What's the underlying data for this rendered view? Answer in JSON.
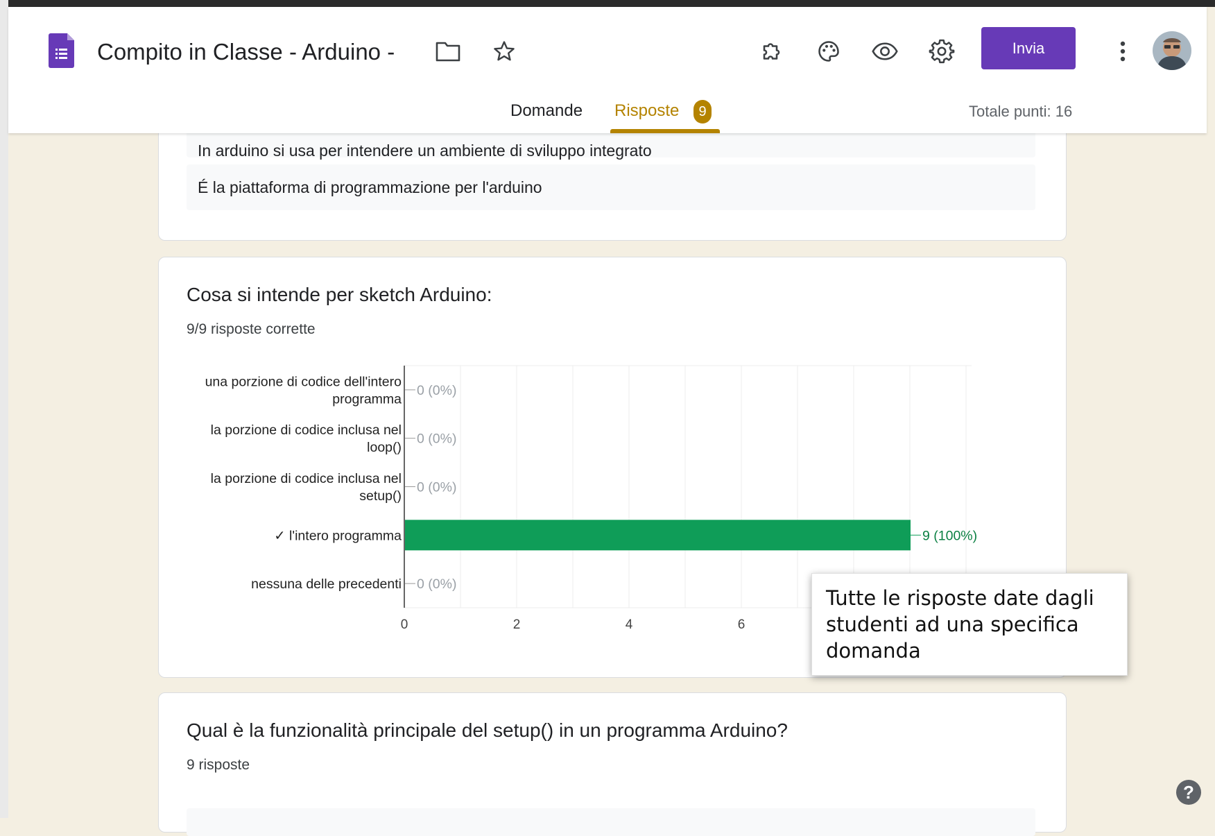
{
  "header": {
    "title": "Compito in Classe - Arduino -",
    "send_label": "Invia",
    "tabs": [
      {
        "label": "Domande"
      },
      {
        "label": "Risposte",
        "badge": "9",
        "active": true
      }
    ],
    "total_points": "Totale punti: 16",
    "icons": [
      "folder-icon",
      "star-icon",
      "addon-icon",
      "palette-icon",
      "preview-icon",
      "settings-icon",
      "more-icon"
    ],
    "accent_color": "#673ab7",
    "tab_accent_color": "#b48300"
  },
  "card1": {
    "answers": [
      "In arduino si usa per intendere un ambiente di sviluppo integrato",
      "É la piattaforma di programmazione per l'arduino"
    ]
  },
  "card2": {
    "question": "Cosa si intende per sketch Arduino:",
    "summary": "9/9 risposte corrette"
  },
  "chart_data": {
    "type": "bar",
    "orientation": "horizontal",
    "categories": [
      "una porzione di codice dell'intero programma",
      "la porzione di codice inclusa nel loop()",
      "la porzione di codice inclusa nel setup()",
      "✓ l'intero programma",
      "nessuna delle precedenti"
    ],
    "category_lines": [
      [
        "una porzione di codice dell'intero",
        "programma"
      ],
      [
        "la porzione di codice inclusa nel",
        "loop()"
      ],
      [
        "la porzione di codice inclusa nel",
        "setup()"
      ],
      [
        "✓ l'intero programma"
      ],
      [
        "nessuna delle precedenti"
      ]
    ],
    "values": [
      0,
      0,
      0,
      9,
      0
    ],
    "labels": [
      "0 (0%)",
      "0 (0%)",
      "0 (0%)",
      "9 (100%)",
      "0 (0%)"
    ],
    "correct_index": 3,
    "xticks": [
      0,
      2,
      4,
      6
    ],
    "xlim": [
      0,
      10
    ],
    "grid": true,
    "bar_color": "#0f9d58"
  },
  "tooltip": {
    "text": "Tutte le risposte date dagli studenti ad una specifica domanda"
  },
  "card3": {
    "question": "Qual è la funzionalità principale del setup() in un programma Arduino?",
    "summary": "9 risposte"
  }
}
